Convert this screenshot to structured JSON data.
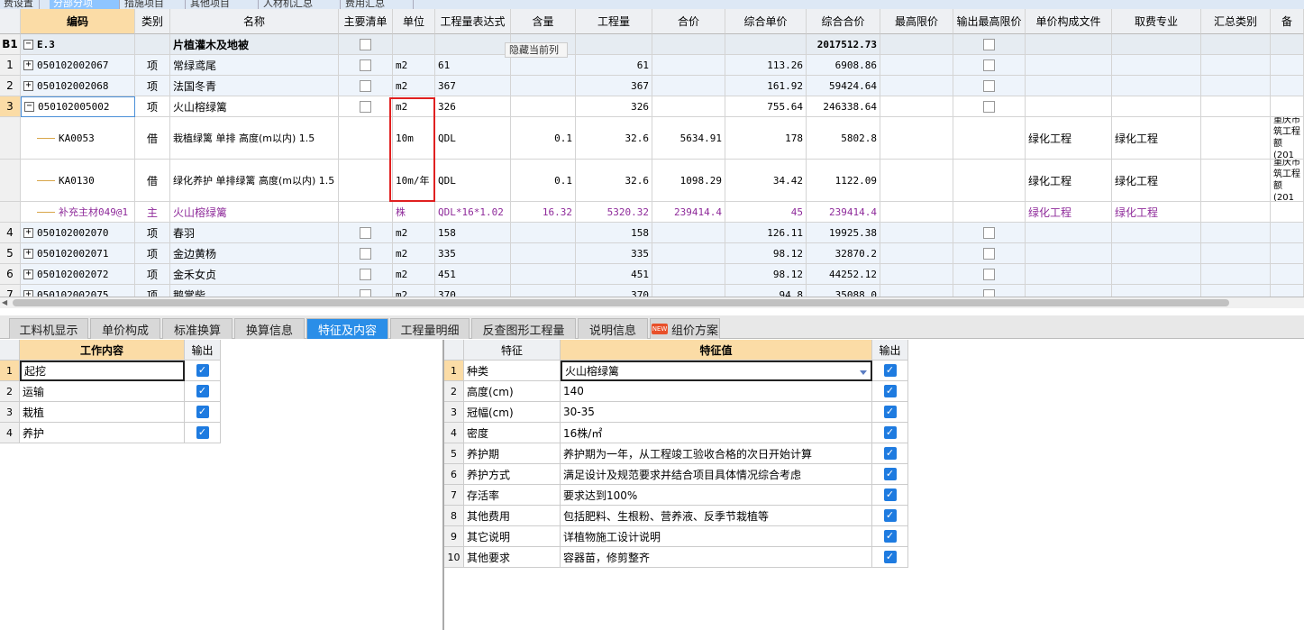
{
  "top_tabs": [
    "费设置",
    "分部分项",
    "措施项目",
    "其他项目",
    "人材机汇总",
    "费用汇总"
  ],
  "grid": {
    "headers": [
      "编码",
      "类别",
      "名称",
      "主要清单",
      "单位",
      "工程量表达式",
      "含量",
      "工程量",
      "合价",
      "综合单价",
      "综合合价",
      "最高限价",
      "输出最高限价",
      "单价构成文件",
      "取费专业",
      "汇总类别",
      "备"
    ],
    "tooltip": "隐藏当前列",
    "rows": [
      {
        "no": "B1",
        "code": "E.3",
        "type": "",
        "name": "片植灌木及地被",
        "unit": "",
        "expr": "",
        "content": "",
        "qty": "",
        "price": "",
        "unit_price": "",
        "total": "2017512.73",
        "file": "",
        "major": "",
        "extra": ""
      },
      {
        "no": "1",
        "code": "050102002067",
        "type": "项",
        "name": "常绿鸢尾",
        "unit": "m2",
        "expr": "61",
        "content": "",
        "qty": "61",
        "price": "",
        "unit_price": "113.26",
        "total": "6908.86",
        "file": "",
        "major": "",
        "extra": ""
      },
      {
        "no": "2",
        "code": "050102002068",
        "type": "项",
        "name": "法国冬青",
        "unit": "m2",
        "expr": "367",
        "content": "",
        "qty": "367",
        "price": "",
        "unit_price": "161.92",
        "total": "59424.64",
        "file": "",
        "major": "",
        "extra": ""
      },
      {
        "no": "3",
        "code": "050102005002",
        "type": "项",
        "name": "火山榕绿篱",
        "unit": "m2",
        "expr": "326",
        "content": "",
        "qty": "326",
        "price": "",
        "unit_price": "755.64",
        "total": "246338.64",
        "file": "",
        "major": "",
        "extra": ""
      },
      {
        "no": "",
        "code": "KA0053",
        "type": "借",
        "name": "栽植绿篱 单排 高度(m以内) 1.5",
        "unit": "10m",
        "expr": "QDL",
        "content": "0.1",
        "qty": "32.6",
        "price": "5634.91",
        "unit_price": "178",
        "total": "5802.8",
        "file": "绿化工程",
        "major": "绿化工程",
        "extra": "重庆市筑工程额(201"
      },
      {
        "no": "",
        "code": "KA0130",
        "type": "借",
        "name": "绿化养护 单排绿篱 高度(m以内) 1.5",
        "unit": "10m/年",
        "expr": "QDL",
        "content": "0.1",
        "qty": "32.6",
        "price": "1098.29",
        "unit_price": "34.42",
        "total": "1122.09",
        "file": "绿化工程",
        "major": "绿化工程",
        "extra": "重庆市筑工程额(201"
      },
      {
        "no": "",
        "code": "补充主材049@1",
        "type": "主",
        "name": "火山榕绿篱",
        "unit": "株",
        "expr": "QDL*16*1.02",
        "content": "16.32",
        "qty": "5320.32",
        "price": "239414.4",
        "unit_price": "45",
        "total": "239414.4",
        "file": "绿化工程",
        "major": "绿化工程",
        "extra": ""
      },
      {
        "no": "4",
        "code": "050102002070",
        "type": "项",
        "name": "春羽",
        "unit": "m2",
        "expr": "158",
        "content": "",
        "qty": "158",
        "price": "",
        "unit_price": "126.11",
        "total": "19925.38",
        "file": "",
        "major": "",
        "extra": ""
      },
      {
        "no": "5",
        "code": "050102002071",
        "type": "项",
        "name": "金边黄杨",
        "unit": "m2",
        "expr": "335",
        "content": "",
        "qty": "335",
        "price": "",
        "unit_price": "98.12",
        "total": "32870.2",
        "file": "",
        "major": "",
        "extra": ""
      },
      {
        "no": "6",
        "code": "050102002072",
        "type": "项",
        "name": "金禾女贞",
        "unit": "m2",
        "expr": "451",
        "content": "",
        "qty": "451",
        "price": "",
        "unit_price": "98.12",
        "total": "44252.12",
        "file": "",
        "major": "",
        "extra": ""
      },
      {
        "no": "7",
        "code": "050102002075",
        "type": "项",
        "name": "鹅掌柴",
        "unit": "m2",
        "expr": "370",
        "content": "",
        "qty": "370",
        "price": "",
        "unit_price": "94.8",
        "total": "35088.0",
        "file": "",
        "major": "",
        "extra": ""
      }
    ]
  },
  "bottom_tabs": [
    "工料机显示",
    "单价构成",
    "标准换算",
    "换算信息",
    "特征及内容",
    "工程量明细",
    "反查图形工程量",
    "说明信息",
    "组价方案"
  ],
  "new_badge": "NEW",
  "work": {
    "headers": [
      "工作内容",
      "输出"
    ],
    "rows": [
      {
        "no": "1",
        "item": "起挖"
      },
      {
        "no": "2",
        "item": "运输"
      },
      {
        "no": "3",
        "item": "栽植"
      },
      {
        "no": "4",
        "item": "养护"
      }
    ]
  },
  "features": {
    "headers": [
      "特征",
      "特征值",
      "输出"
    ],
    "rows": [
      {
        "no": "1",
        "name": "种类",
        "value": "火山榕绿篱"
      },
      {
        "no": "2",
        "name": "高度(cm)",
        "value": "140"
      },
      {
        "no": "3",
        "name": "冠幅(cm)",
        "value": "30-35"
      },
      {
        "no": "4",
        "name": "密度",
        "value": "16株/㎡"
      },
      {
        "no": "5",
        "name": "养护期",
        "value": "养护期为一年，从工程竣工验收合格的次日开始计算"
      },
      {
        "no": "6",
        "name": "养护方式",
        "value": "满足设计及规范要求并结合项目具体情况综合考虑"
      },
      {
        "no": "7",
        "name": "存活率",
        "value": "要求达到100%"
      },
      {
        "no": "8",
        "name": "其他费用",
        "value": "包括肥料、生根粉、营养液、反季节栽植等"
      },
      {
        "no": "9",
        "name": "其它说明",
        "value": "详植物施工设计说明"
      },
      {
        "no": "10",
        "name": "其他要求",
        "value": "容器苗，修剪整齐"
      }
    ]
  },
  "colors": {
    "accent": "#2a8ee8",
    "header_selected": "#fbdca6",
    "purple_row": "#8e2a9a",
    "highlight_box": "#e02020"
  }
}
